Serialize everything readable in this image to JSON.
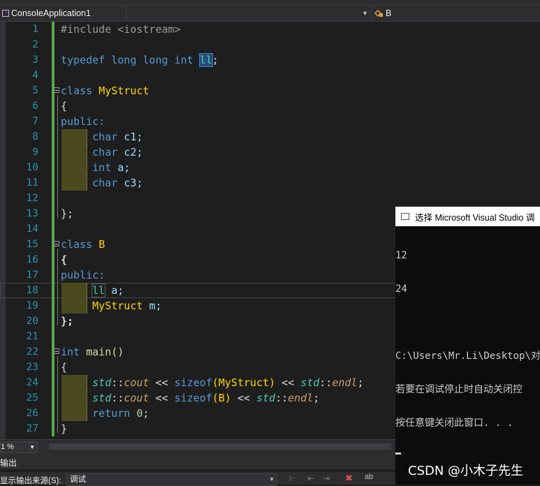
{
  "navbar": {
    "project": "ConsoleApplication1",
    "scope": "",
    "member": "B"
  },
  "editor": {
    "lines": [
      {
        "n": "1"
      },
      {
        "n": "2"
      },
      {
        "n": "3"
      },
      {
        "n": "4"
      },
      {
        "n": "5"
      },
      {
        "n": "6"
      },
      {
        "n": "7"
      },
      {
        "n": "8"
      },
      {
        "n": "9"
      },
      {
        "n": "10"
      },
      {
        "n": "11"
      },
      {
        "n": "12"
      },
      {
        "n": "13"
      },
      {
        "n": "14"
      },
      {
        "n": "15"
      },
      {
        "n": "16"
      },
      {
        "n": "17"
      },
      {
        "n": "18"
      },
      {
        "n": "19"
      },
      {
        "n": "20"
      },
      {
        "n": "21"
      },
      {
        "n": "22"
      },
      {
        "n": "23"
      },
      {
        "n": "24"
      },
      {
        "n": "25"
      },
      {
        "n": "26"
      },
      {
        "n": "27"
      }
    ],
    "code": {
      "l1": "#include <iostream>",
      "l3a": "typedef",
      "l3b": "long",
      "l3c": "long",
      "l3d": "int",
      "l3e": "ll",
      "l3f": ";",
      "l5a": "class",
      "l5b": "MyStruct",
      "l6": "{",
      "l7": "public:",
      "l8a": "char",
      "l8b": "c1;",
      "l9a": "char",
      "l9b": "c2;",
      "l10a": "int",
      "l10b": "a;",
      "l11a": "char",
      "l11b": "c3;",
      "l13": "};",
      "l15a": "class",
      "l15b": "B",
      "l16": "{",
      "l17": "public:",
      "l18a": "ll",
      "l18b": "a;",
      "l19a": "MyStruct",
      "l19b": "m;",
      "l20": "};",
      "l22a": "int",
      "l22b": "main()",
      "l23": "{",
      "l24a": "std",
      "l24b": "::",
      "l24c": "cout",
      "l24d": "<<",
      "l24e": "sizeof",
      "l24f": "(MyStruct)",
      "l24g": "<<",
      "l24h": "std",
      "l24i": "::",
      "l24j": "endl",
      "l24k": ";",
      "l25a": "std",
      "l25b": "::",
      "l25c": "cout",
      "l25d": "<<",
      "l25e": "sizeof",
      "l25f": "(B)",
      "l25g": "<<",
      "l25h": "std",
      "l25i": "::",
      "l25j": "endl",
      "l25k": ";",
      "l26a": "return",
      "l26b": "0",
      "l26c": ";",
      "l27": "}"
    }
  },
  "console": {
    "title": "选择 Microsoft Visual Studio 调",
    "lines": [
      "12",
      "24",
      "",
      "C:\\Users\\Mr.Li\\Desktop\\对象",
      "若要在调试停止时自动关闭控",
      "按任意键关闭此窗口. . ."
    ]
  },
  "statusbar": {
    "zoom": "1 %"
  },
  "output": {
    "title": "输出",
    "source_label": "显示输出来源(S):",
    "source_value": "调试"
  },
  "watermark": "CSDN @小木子先生"
}
